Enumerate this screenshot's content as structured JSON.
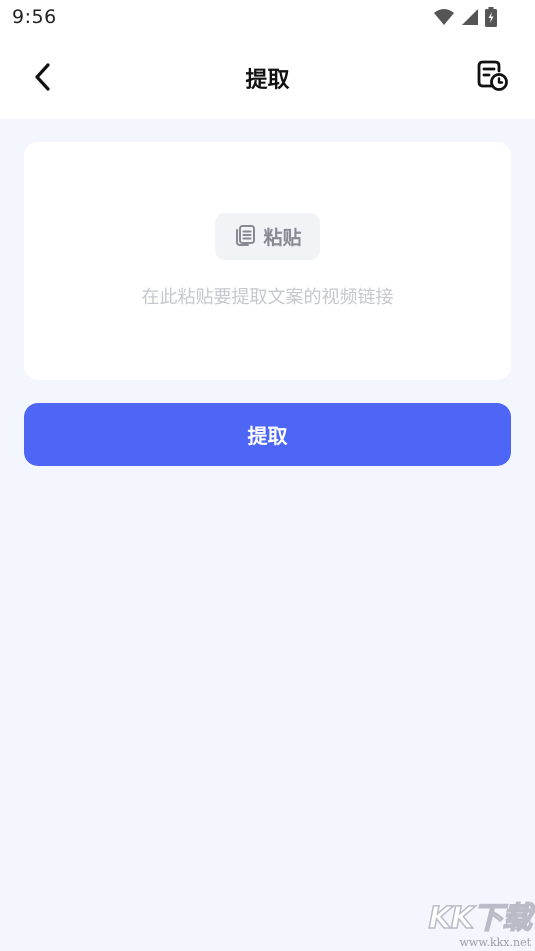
{
  "status_bar": {
    "time": "9:56",
    "icons": [
      "wifi-icon",
      "cell-signal-icon",
      "battery-charging-icon"
    ]
  },
  "header": {
    "title": "提取",
    "back_icon": "chevron-left-icon",
    "history_icon": "document-clock-icon"
  },
  "input_card": {
    "paste_label": "粘贴",
    "paste_icon": "copy-icon",
    "placeholder": "在此粘贴要提取文案的视频链接"
  },
  "extract_button": {
    "label": "提取"
  },
  "watermark": {
    "logo": "KK下载",
    "url": "www.kkx.net"
  },
  "colors": {
    "page_background": "#f4f6fe",
    "primary_button": "#4d66f5",
    "placeholder_text": "#c6c8ce"
  }
}
